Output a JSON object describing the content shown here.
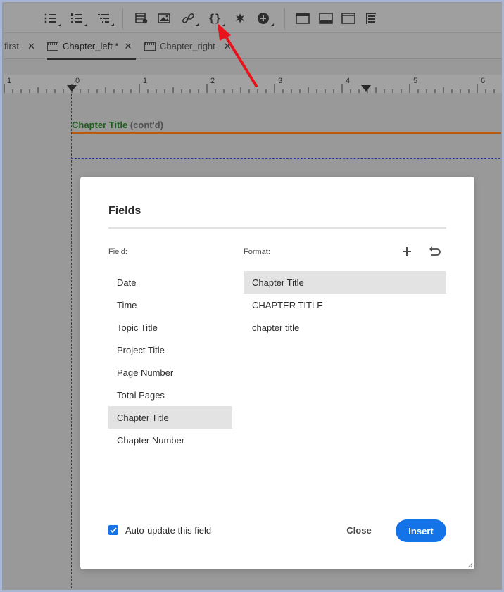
{
  "toolbar": {
    "icons": [
      "bulleted-list-icon",
      "numbered-list-icon",
      "multilevel-list-icon",
      "insert-table-icon",
      "insert-image-icon",
      "insert-link-icon",
      "insert-field-icon",
      "insert-symbol-icon",
      "insert-plus-icon",
      "layout-header-icon",
      "layout-footer-icon",
      "layout-page-icon",
      "layout-toc-icon"
    ]
  },
  "tabs": [
    {
      "label": "first",
      "active": false
    },
    {
      "label": "Chapter_left *",
      "active": true
    },
    {
      "label": "Chapter_right",
      "active": false
    }
  ],
  "ruler": {
    "labels": [
      "1",
      "0",
      "1",
      "2",
      "3",
      "4",
      "5",
      "6"
    ]
  },
  "page": {
    "header_title": "Chapter Title",
    "header_suffix": "(cont'd)"
  },
  "dialog": {
    "title": "Fields",
    "field_label": "Field:",
    "format_label": "Format:",
    "fields": [
      "Date",
      "Time",
      "Topic Title",
      "Project Title",
      "Page Number",
      "Total Pages",
      "Chapter Title",
      "Chapter Number"
    ],
    "selected_field": "Chapter Title",
    "formats": [
      "Chapter Title",
      "CHAPTER TITLE",
      "chapter title"
    ],
    "selected_format": "Chapter Title",
    "auto_update_label": "Auto-update this field",
    "auto_update_checked": true,
    "close_label": "Close",
    "insert_label": "Insert"
  },
  "colors": {
    "accent": "#1473e6",
    "annotation_arrow": "#e8141b",
    "header_rule": "#b85a10",
    "header_title": "#1f5d1f"
  }
}
